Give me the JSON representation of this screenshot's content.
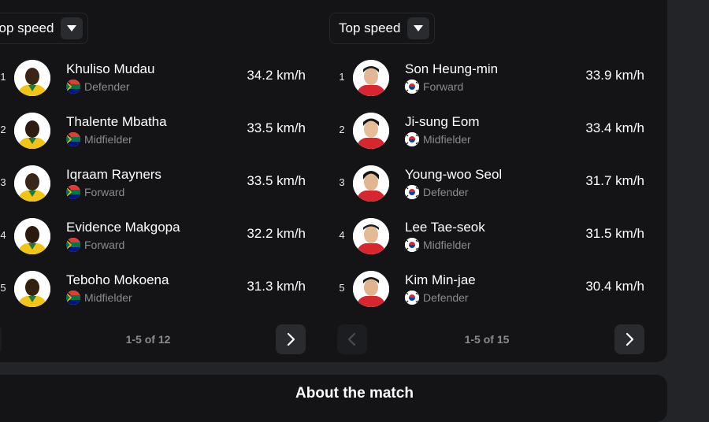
{
  "left": {
    "dropdown_label": "Top speed",
    "pager_text": "1-5 of 12",
    "rows": [
      {
        "rank": "1",
        "name": "Khuliso Mudau",
        "position": "Defender",
        "speed": "34.2 km/h"
      },
      {
        "rank": "2",
        "name": "Thalente Mbatha",
        "position": "Midfielder",
        "speed": "33.5 km/h"
      },
      {
        "rank": "3",
        "name": "Iqraam Rayners",
        "position": "Forward",
        "speed": "33.5 km/h"
      },
      {
        "rank": "4",
        "name": "Evidence Makgopa",
        "position": "Forward",
        "speed": "32.2 km/h"
      },
      {
        "rank": "5",
        "name": "Teboho Mokoena",
        "position": "Midfielder",
        "speed": "31.3 km/h"
      }
    ]
  },
  "right": {
    "dropdown_label": "Top speed",
    "pager_text": "1-5 of 15",
    "rows": [
      {
        "rank": "1",
        "name": "Son Heung-min",
        "position": "Forward",
        "speed": "33.9 km/h"
      },
      {
        "rank": "2",
        "name": "Ji-sung Eom",
        "position": "Midfielder",
        "speed": "33.4 km/h"
      },
      {
        "rank": "3",
        "name": "Young-woo Seol",
        "position": "Defender",
        "speed": "31.7 km/h"
      },
      {
        "rank": "4",
        "name": "Lee Tae-seok",
        "position": "Midfielder",
        "speed": "31.5 km/h"
      },
      {
        "rank": "5",
        "name": "Kim Min-jae",
        "position": "Defender",
        "speed": "30.4 km/h"
      }
    ]
  },
  "about": {
    "title": "About the match"
  },
  "colors": {
    "card": "#141416",
    "background": "#232427",
    "muted": "#8a8b8f",
    "kit_south_africa": "#f2c418",
    "kit_korea": "#d8262f"
  },
  "icons": {
    "flag_left": "south-africa-flag-icon",
    "flag_right": "south-korea-flag-icon",
    "prev": "chevron-left-icon",
    "next": "chevron-right-icon",
    "dropdown": "caret-down-icon"
  }
}
